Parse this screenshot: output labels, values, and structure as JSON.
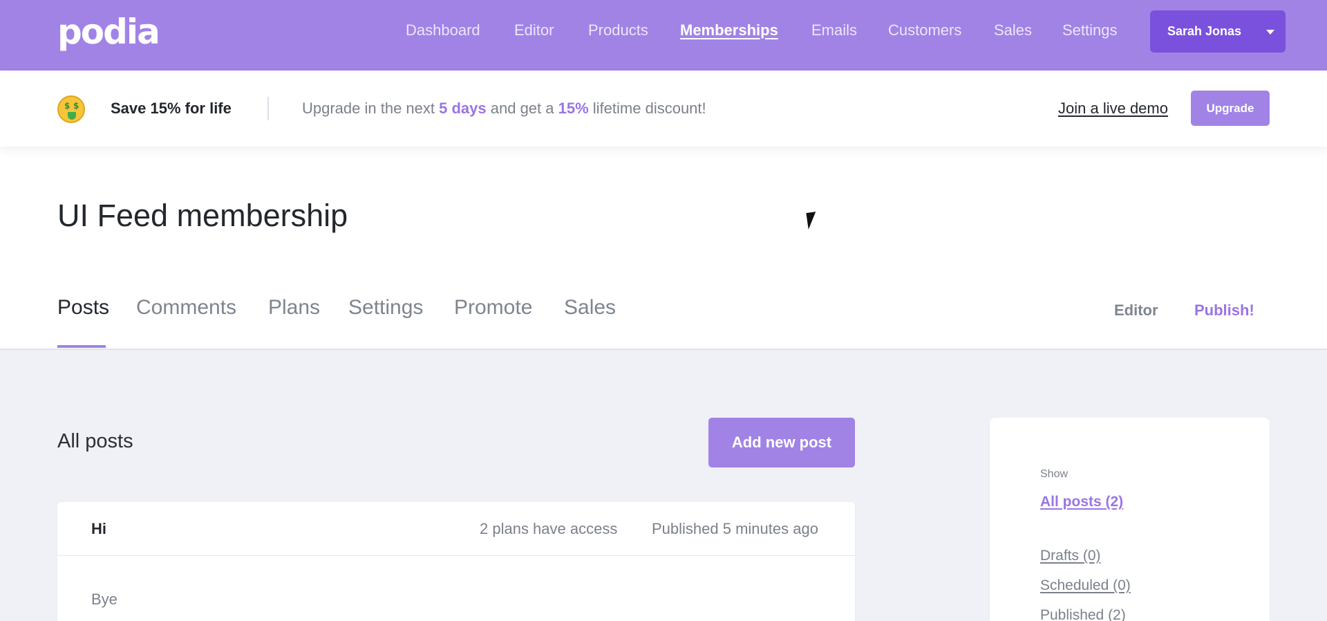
{
  "nav": {
    "logo": "podia",
    "links": [
      "Dashboard",
      "Editor",
      "Products",
      "Memberships",
      "Emails",
      "Customers",
      "Sales",
      "Settings"
    ],
    "active": "Memberships",
    "user_name": "Sarah Jonas"
  },
  "promo": {
    "title": "Save 15% for life",
    "text_prefix": "Upgrade in the next ",
    "days": "5 days",
    "text_middle": " and get a ",
    "percent": "15%",
    "text_suffix": " lifetime discount!",
    "demo_link": "Join a live demo",
    "upgrade_label": "Upgrade"
  },
  "page": {
    "title": "UI Feed membership",
    "tabs": [
      "Posts",
      "Comments",
      "Plans",
      "Settings",
      "Promote",
      "Sales"
    ],
    "active_tab": "Posts",
    "editor_link": "Editor",
    "publish_link": "Publish!"
  },
  "posts": {
    "section_title": "All posts",
    "add_button": "Add new post",
    "items": [
      {
        "title": "Hi",
        "access": "2 plans have access",
        "status": "Published 5 minutes ago",
        "body": "Bye"
      }
    ]
  },
  "filters": {
    "label": "Show",
    "items": [
      "All posts (2)",
      "Drafts (0)",
      "Scheduled (0)",
      "Published (2)"
    ],
    "active": "All posts (2)"
  },
  "colors": {
    "brand": "#a183e6",
    "brand_dark": "#7a51dd",
    "accent_text": "#9a74e5"
  }
}
